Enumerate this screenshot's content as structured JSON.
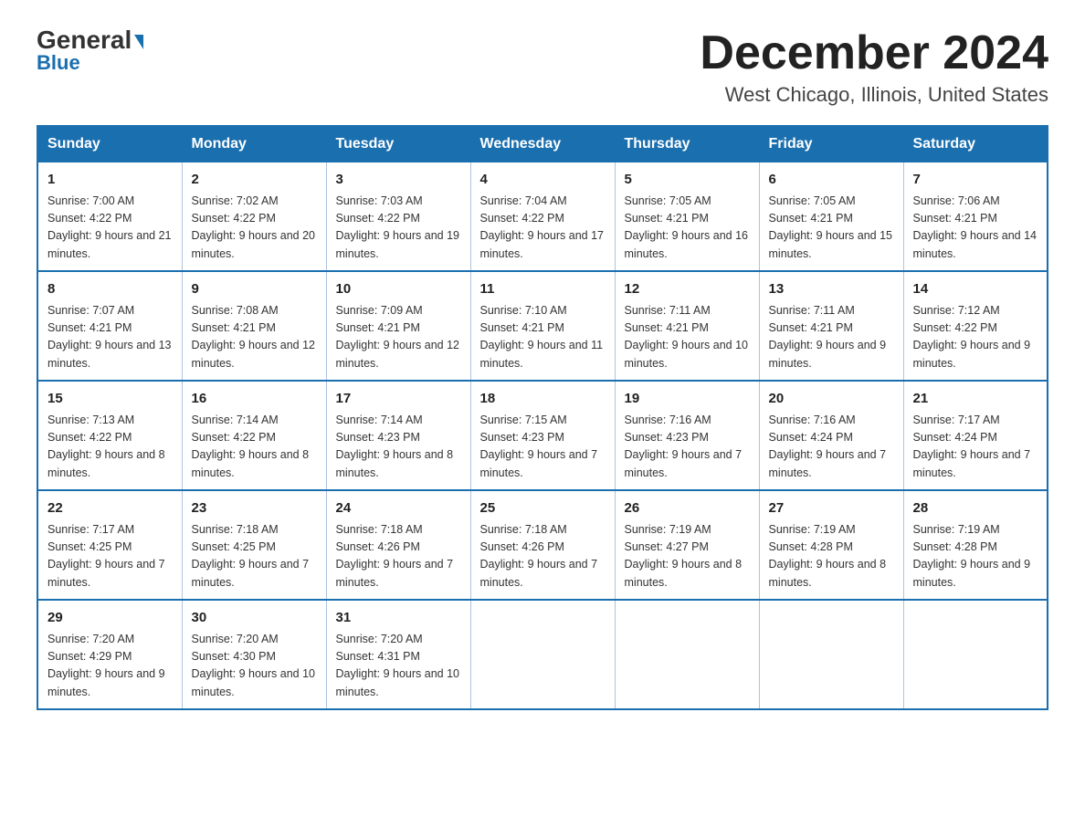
{
  "header": {
    "logo_line1": "General",
    "logo_line2": "Blue",
    "month_title": "December 2024",
    "location": "West Chicago, Illinois, United States"
  },
  "days_of_week": [
    "Sunday",
    "Monday",
    "Tuesday",
    "Wednesday",
    "Thursday",
    "Friday",
    "Saturday"
  ],
  "weeks": [
    [
      {
        "day": "1",
        "sunrise": "7:00 AM",
        "sunset": "4:22 PM",
        "daylight": "9 hours and 21 minutes."
      },
      {
        "day": "2",
        "sunrise": "7:02 AM",
        "sunset": "4:22 PM",
        "daylight": "9 hours and 20 minutes."
      },
      {
        "day": "3",
        "sunrise": "7:03 AM",
        "sunset": "4:22 PM",
        "daylight": "9 hours and 19 minutes."
      },
      {
        "day": "4",
        "sunrise": "7:04 AM",
        "sunset": "4:22 PM",
        "daylight": "9 hours and 17 minutes."
      },
      {
        "day": "5",
        "sunrise": "7:05 AM",
        "sunset": "4:21 PM",
        "daylight": "9 hours and 16 minutes."
      },
      {
        "day": "6",
        "sunrise": "7:05 AM",
        "sunset": "4:21 PM",
        "daylight": "9 hours and 15 minutes."
      },
      {
        "day": "7",
        "sunrise": "7:06 AM",
        "sunset": "4:21 PM",
        "daylight": "9 hours and 14 minutes."
      }
    ],
    [
      {
        "day": "8",
        "sunrise": "7:07 AM",
        "sunset": "4:21 PM",
        "daylight": "9 hours and 13 minutes."
      },
      {
        "day": "9",
        "sunrise": "7:08 AM",
        "sunset": "4:21 PM",
        "daylight": "9 hours and 12 minutes."
      },
      {
        "day": "10",
        "sunrise": "7:09 AM",
        "sunset": "4:21 PM",
        "daylight": "9 hours and 12 minutes."
      },
      {
        "day": "11",
        "sunrise": "7:10 AM",
        "sunset": "4:21 PM",
        "daylight": "9 hours and 11 minutes."
      },
      {
        "day": "12",
        "sunrise": "7:11 AM",
        "sunset": "4:21 PM",
        "daylight": "9 hours and 10 minutes."
      },
      {
        "day": "13",
        "sunrise": "7:11 AM",
        "sunset": "4:21 PM",
        "daylight": "9 hours and 9 minutes."
      },
      {
        "day": "14",
        "sunrise": "7:12 AM",
        "sunset": "4:22 PM",
        "daylight": "9 hours and 9 minutes."
      }
    ],
    [
      {
        "day": "15",
        "sunrise": "7:13 AM",
        "sunset": "4:22 PM",
        "daylight": "9 hours and 8 minutes."
      },
      {
        "day": "16",
        "sunrise": "7:14 AM",
        "sunset": "4:22 PM",
        "daylight": "9 hours and 8 minutes."
      },
      {
        "day": "17",
        "sunrise": "7:14 AM",
        "sunset": "4:23 PM",
        "daylight": "9 hours and 8 minutes."
      },
      {
        "day": "18",
        "sunrise": "7:15 AM",
        "sunset": "4:23 PM",
        "daylight": "9 hours and 7 minutes."
      },
      {
        "day": "19",
        "sunrise": "7:16 AM",
        "sunset": "4:23 PM",
        "daylight": "9 hours and 7 minutes."
      },
      {
        "day": "20",
        "sunrise": "7:16 AM",
        "sunset": "4:24 PM",
        "daylight": "9 hours and 7 minutes."
      },
      {
        "day": "21",
        "sunrise": "7:17 AM",
        "sunset": "4:24 PM",
        "daylight": "9 hours and 7 minutes."
      }
    ],
    [
      {
        "day": "22",
        "sunrise": "7:17 AM",
        "sunset": "4:25 PM",
        "daylight": "9 hours and 7 minutes."
      },
      {
        "day": "23",
        "sunrise": "7:18 AM",
        "sunset": "4:25 PM",
        "daylight": "9 hours and 7 minutes."
      },
      {
        "day": "24",
        "sunrise": "7:18 AM",
        "sunset": "4:26 PM",
        "daylight": "9 hours and 7 minutes."
      },
      {
        "day": "25",
        "sunrise": "7:18 AM",
        "sunset": "4:26 PM",
        "daylight": "9 hours and 7 minutes."
      },
      {
        "day": "26",
        "sunrise": "7:19 AM",
        "sunset": "4:27 PM",
        "daylight": "9 hours and 8 minutes."
      },
      {
        "day": "27",
        "sunrise": "7:19 AM",
        "sunset": "4:28 PM",
        "daylight": "9 hours and 8 minutes."
      },
      {
        "day": "28",
        "sunrise": "7:19 AM",
        "sunset": "4:28 PM",
        "daylight": "9 hours and 9 minutes."
      }
    ],
    [
      {
        "day": "29",
        "sunrise": "7:20 AM",
        "sunset": "4:29 PM",
        "daylight": "9 hours and 9 minutes."
      },
      {
        "day": "30",
        "sunrise": "7:20 AM",
        "sunset": "4:30 PM",
        "daylight": "9 hours and 10 minutes."
      },
      {
        "day": "31",
        "sunrise": "7:20 AM",
        "sunset": "4:31 PM",
        "daylight": "9 hours and 10 minutes."
      },
      null,
      null,
      null,
      null
    ]
  ]
}
